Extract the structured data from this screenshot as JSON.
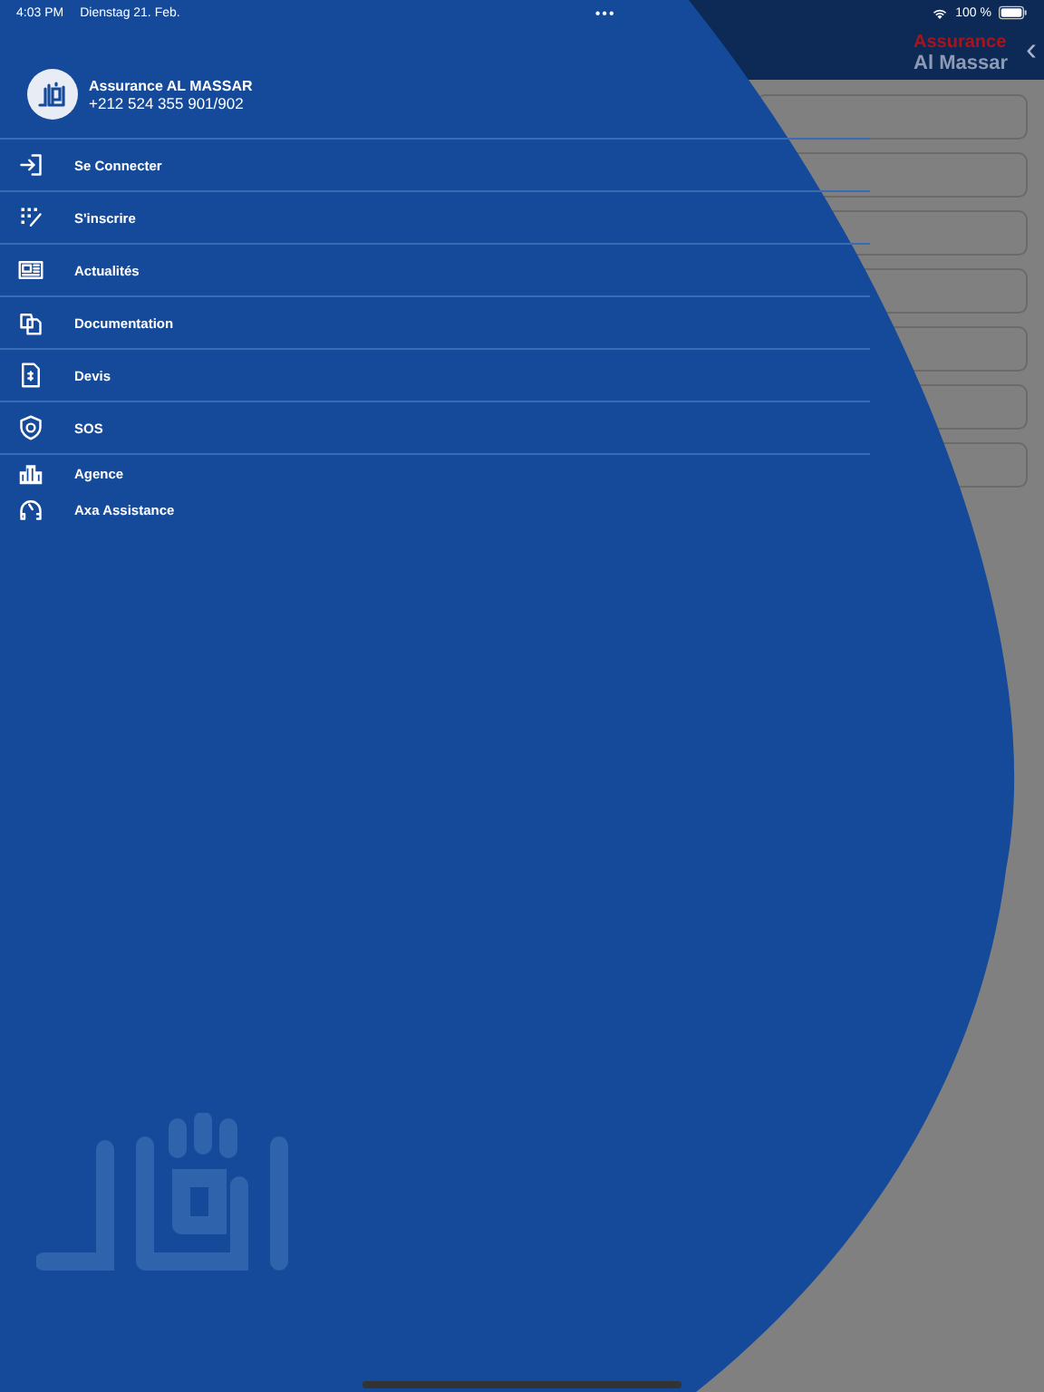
{
  "status_bar": {
    "time": "4:03 PM",
    "date": "Dienstag 21. Feb.",
    "dots": "•••",
    "battery": "100 %"
  },
  "header": {
    "brand_top": "Assurance",
    "brand_bottom": "Al Massar",
    "back": "‹"
  },
  "background_fields": [
    {
      "kind": "field"
    },
    {
      "kind": "field"
    },
    {
      "kind": "field"
    },
    {
      "kind": "field"
    },
    {
      "kind": "field"
    },
    {
      "kind": "field"
    },
    {
      "kind": "field"
    }
  ],
  "drawer": {
    "title": "Assurance AL MASSAR",
    "phone": "+212 524 355 901/902",
    "items": [
      {
        "label": "Se Connecter",
        "divider_below": true
      },
      {
        "label": "S'inscrire",
        "divider_below": true
      },
      {
        "label": "Actualités",
        "divider_below": true
      },
      {
        "label": "Documentation",
        "divider_below": true
      },
      {
        "label": "Devis",
        "divider_below": true
      },
      {
        "label": "SOS",
        "divider_below": true
      },
      {
        "label": "Agence",
        "divider_below": false
      },
      {
        "label": "Axa Assistance",
        "divider_below": false
      }
    ]
  }
}
